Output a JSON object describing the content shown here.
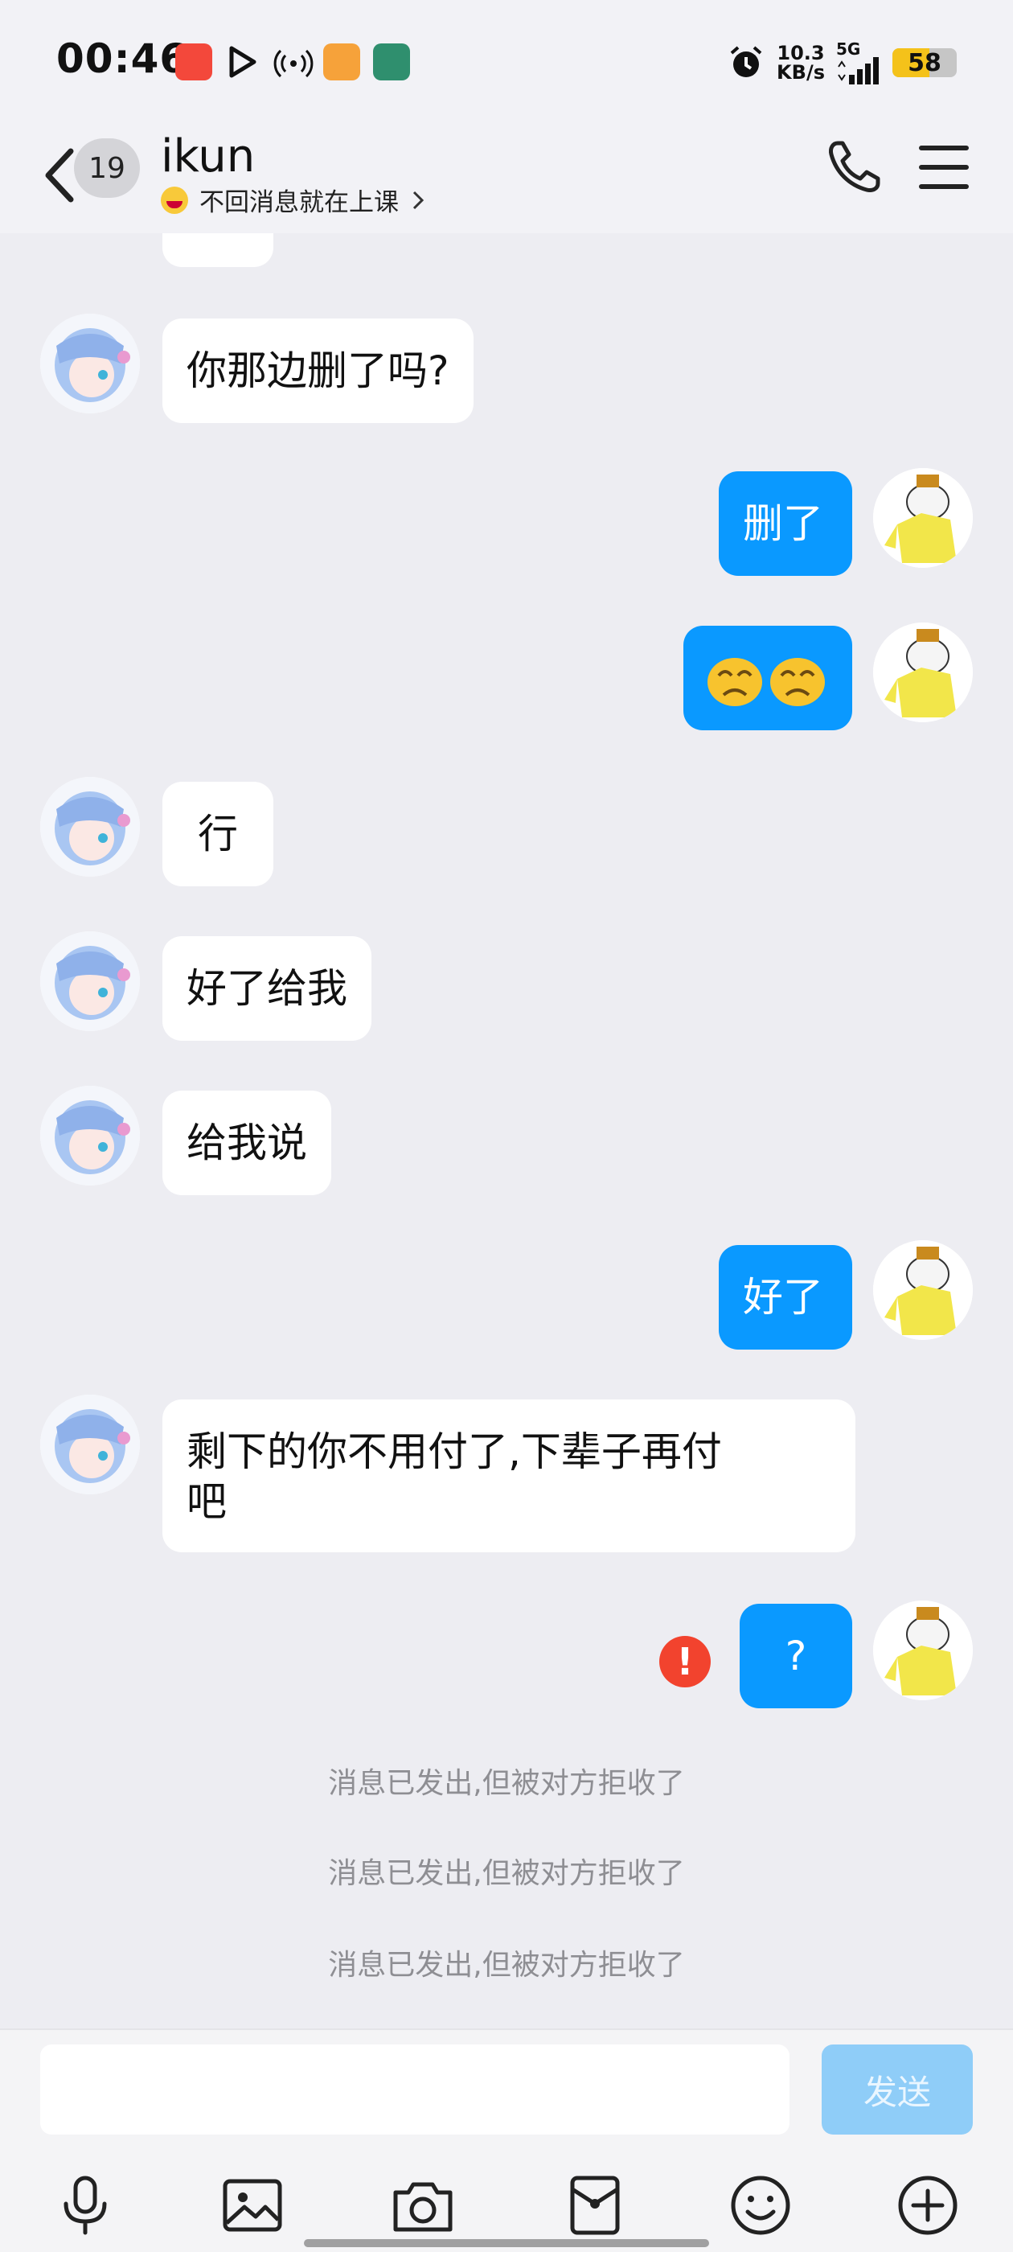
{
  "status_bar": {
    "time": "00:46",
    "speed_value": "10.3",
    "speed_unit": "KB/s",
    "network": "5G",
    "battery": "58",
    "battery_level": 0.58,
    "accent_colors": {
      "battery": "#f4c21a"
    }
  },
  "header": {
    "unread_count": "19",
    "contact_name": "ikun",
    "status_text": "不回消息就在上课",
    "icons": [
      "back-arrow-icon",
      "phone-icon",
      "menu-icon"
    ]
  },
  "messages": [
    {
      "side": "in",
      "text": "你那边删了吗?"
    },
    {
      "side": "out",
      "text": "删了"
    },
    {
      "side": "out",
      "text": "😟😟"
    },
    {
      "side": "in",
      "text": "行"
    },
    {
      "side": "in",
      "text": "好了给我"
    },
    {
      "side": "in",
      "text": "给我说"
    },
    {
      "side": "out",
      "text": "好了"
    },
    {
      "side": "in",
      "text": "剩下的你不用付了,下辈子再付\n吧"
    },
    {
      "side": "out",
      "text": "?",
      "failed": true
    }
  ],
  "system_notes": [
    "消息已发出,但被对方拒收了",
    "消息已发出,但被对方拒收了",
    "消息已发出,但被对方拒收了"
  ],
  "input": {
    "value": "",
    "send_label": "发送"
  },
  "toolbar": [
    "microphone-icon",
    "image-icon",
    "camera-icon",
    "red-packet-icon",
    "emoji-icon",
    "plus-icon"
  ],
  "colors": {
    "outgoing_bubble": "#0a99ff",
    "incoming_bubble": "#ffffff",
    "error": "#f2432e",
    "send_button": "#8fcdf8"
  }
}
